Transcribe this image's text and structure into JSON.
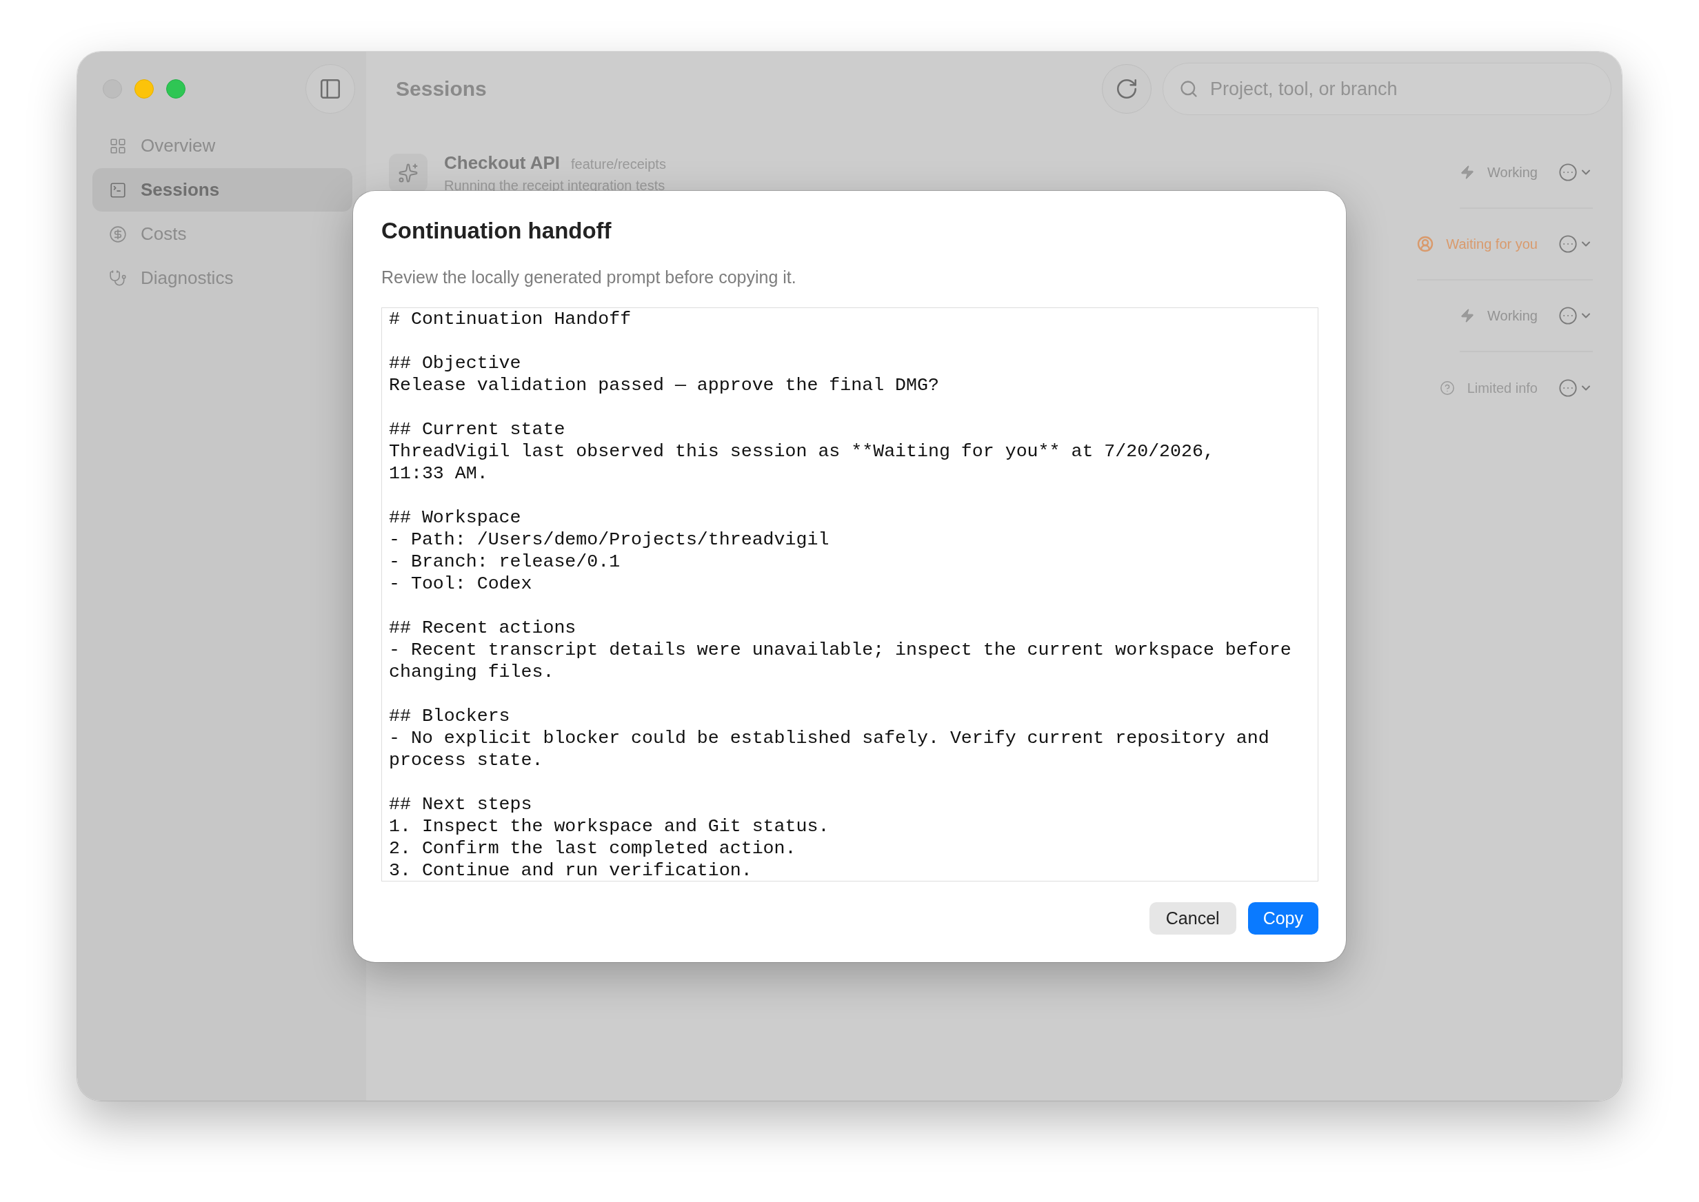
{
  "window": {
    "title": "Sessions"
  },
  "sidebar": {
    "items": [
      {
        "label": "Overview",
        "selected": false
      },
      {
        "label": "Sessions",
        "selected": true
      },
      {
        "label": "Costs",
        "selected": false
      },
      {
        "label": "Diagnostics",
        "selected": false
      }
    ]
  },
  "toolbar": {
    "search": {
      "placeholder": "Project, tool, or branch"
    }
  },
  "sessions": [
    {
      "title": "Checkout API",
      "branch": "feature/receipts",
      "summary": "Running the receipt integration tests",
      "status": {
        "kind": "working",
        "label": "Working"
      }
    },
    {
      "status": {
        "kind": "waiting",
        "label": "Waiting for you"
      }
    },
    {
      "status": {
        "kind": "working",
        "label": "Working"
      }
    },
    {
      "status": {
        "kind": "limited",
        "label": "Limited info"
      }
    }
  ],
  "dialog": {
    "title": "Continuation handoff",
    "description": "Review the locally generated prompt before copying it.",
    "prompt": "# Continuation Handoff\n\n## Objective\nRelease validation passed — approve the final DMG?\n\n## Current state\nThreadVigil last observed this session as **Waiting for you** at 7/20/2026, 11:33 AM.\n\n## Workspace\n- Path: /Users/demo/Projects/threadvigil\n- Branch: release/0.1\n- Tool: Codex\n\n## Recent actions\n- Recent transcript details were unavailable; inspect the current workspace before changing files.\n\n## Blockers\n- No explicit blocker could be established safely. Verify current repository and process state.\n\n## Next steps\n1. Inspect the workspace and Git status.\n2. Confirm the last completed action.\n3. Continue and run verification.",
    "buttons": [
      {
        "label": "Cancel",
        "kind": "secondary"
      },
      {
        "label": "Copy",
        "kind": "primary"
      }
    ]
  }
}
